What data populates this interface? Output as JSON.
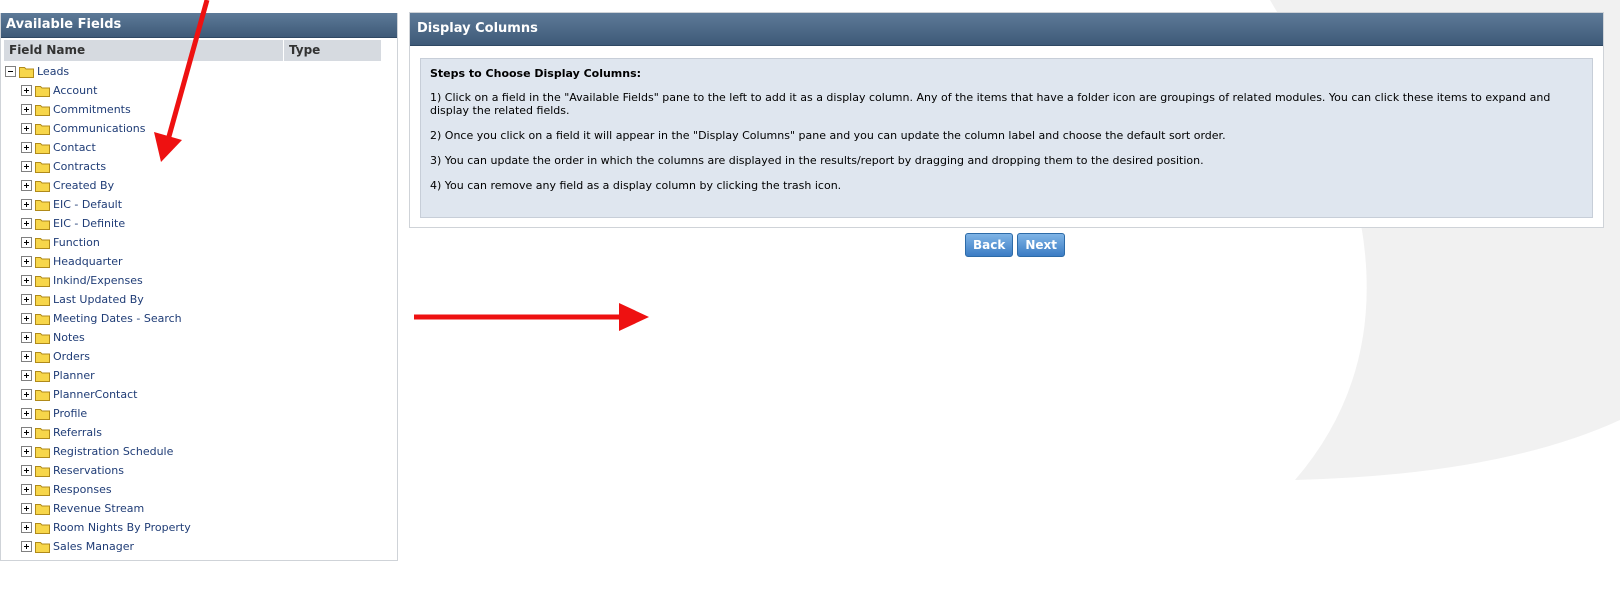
{
  "fields_panel": {
    "title": "Available Fields",
    "columns": [
      "Field Name",
      "Type"
    ],
    "root": "Leads",
    "items": [
      "Account",
      "Commitments",
      "Communications",
      "Contact",
      "Contracts",
      "Created By",
      "EIC - Default",
      "EIC - Definite",
      "Function",
      "Headquarter",
      "Inkind/Expenses",
      "Last Updated By",
      "Meeting Dates - Search",
      "Notes",
      "Orders",
      "Planner",
      "PlannerContact",
      "Profile",
      "Referrals",
      "Registration Schedule",
      "Reservations",
      "Responses",
      "Revenue Stream",
      "Room Nights By Property",
      "Sales Manager"
    ]
  },
  "display_panel": {
    "title": "Display Columns",
    "steps_title": "Steps to Choose Display Columns:",
    "steps": [
      "1) Click on a field in the \"Available Fields\" pane to the left to add it as a display column. Any of the items that have a folder icon are groupings of related modules. You can click these items to expand and display the related fields.",
      "2) Once you click on a field it will appear in the \"Display Columns\" pane and you can update the column label and choose the default sort order.",
      "3) You can update the order in which the columns are displayed in the results/report by dragging and dropping them to the desired position.",
      "4) You can remove any field as a display column by clicking the trash icon."
    ]
  },
  "buttons": {
    "back": "Back",
    "next": "Next"
  },
  "icons": {
    "tree_folder": "folder-icon",
    "expand": "plus-box-icon",
    "collapse": "minus-box-icon"
  },
  "colors": {
    "header_bg": "#4a6686",
    "steps_bg": "#dfe6ef",
    "button_bg": "#3b7cc4",
    "link_text": "#1f3c76",
    "annotation_arrow": "#ee1111"
  }
}
